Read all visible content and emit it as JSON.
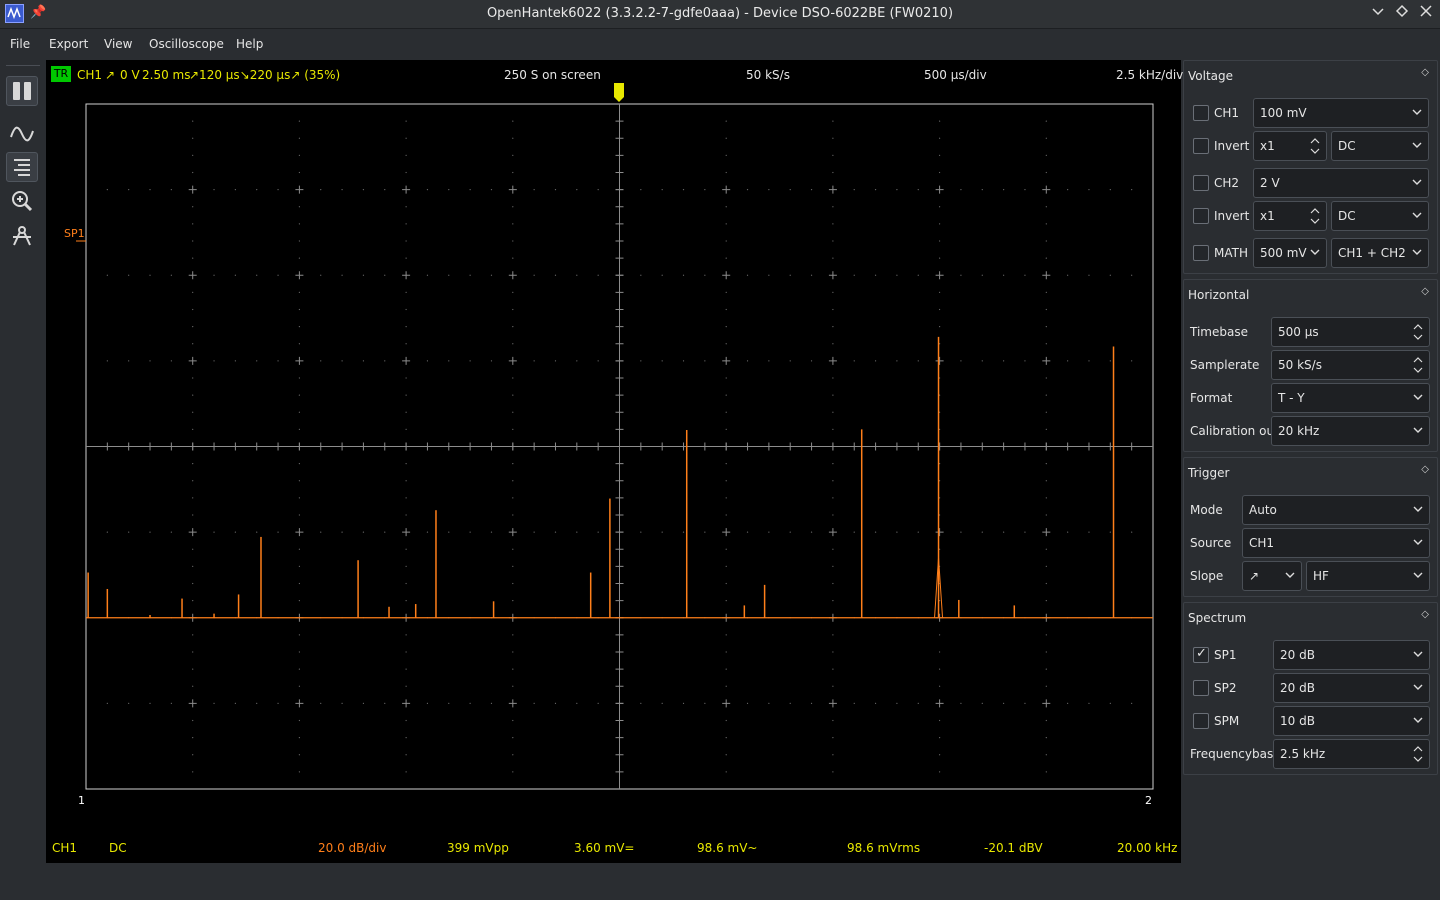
{
  "window": {
    "title": "OpenHantek6022 (3.3.2.2-7-gdfe0aaa) - Device DSO-6022BE (FW0210)"
  },
  "menu": [
    "File",
    "Export",
    "View",
    "Oscilloscope",
    "Help"
  ],
  "toolbar": {
    "items": [
      "pause-icon",
      "waveform-icon",
      "zoom-lines-icon",
      "zoom-icon",
      "measure-icon"
    ]
  },
  "scope": {
    "trigger_badge": "TR",
    "channel": "CH1",
    "slope_symbol": "↗",
    "trigger_level": "0 V",
    "trigger_pos": "2.50 ms",
    "pulse_info": "↗120 µs↘220 µs↗ (35%)",
    "samples_on_screen": "250 S on screen",
    "samplerate": "50 kS/s",
    "timebase": "500 µs/div",
    "freqbase": "2.5 kHz/div",
    "marker_label": "SP1",
    "cursor_1": "1",
    "cursor_2": "2",
    "colors": {
      "trace": "#ff7f1a",
      "grid": "#8c8c8c",
      "trigger": "#e8e800",
      "badge": "#00c800"
    }
  },
  "footer": {
    "channel": "CH1",
    "coupling": "DC",
    "db_div": "20.0 dB/div",
    "vpp": "399 mVpp",
    "vdc": "3.60 mV=",
    "vac": "98.6 mV~",
    "vrms": "98.6 mVrms",
    "dbv": "-20.1 dBV",
    "freq": "20.00 kHz"
  },
  "voltage": {
    "title": "Voltage",
    "ch1": {
      "label": "CH1",
      "checked": false,
      "gain": "100 mV"
    },
    "ch1_invert": {
      "label": "Invert",
      "checked": false,
      "probe": "x1",
      "coupling": "DC"
    },
    "ch2": {
      "label": "CH2",
      "checked": false,
      "gain": "2 V"
    },
    "ch2_invert": {
      "label": "Invert",
      "checked": false,
      "probe": "x1",
      "coupling": "DC"
    },
    "math": {
      "label": "MATH",
      "checked": false,
      "gain": "500 mV",
      "mode": "CH1 + CH2"
    }
  },
  "horizontal": {
    "title": "Horizontal",
    "timebase_label": "Timebase",
    "timebase": "500 µs",
    "samplerate_label": "Samplerate",
    "samplerate": "50 kS/s",
    "format_label": "Format",
    "format": "T - Y",
    "calibration_label": "Calibration out",
    "calibration": "20 kHz"
  },
  "trigger": {
    "title": "Trigger",
    "mode_label": "Mode",
    "mode": "Auto",
    "source_label": "Source",
    "source": "CH1",
    "slope_label": "Slope",
    "slope": "↗",
    "filter": "HF"
  },
  "spectrum": {
    "title": "Spectrum",
    "sp1": {
      "label": "SP1",
      "checked": true,
      "value": "20 dB"
    },
    "sp2": {
      "label": "SP2",
      "checked": false,
      "value": "20 dB"
    },
    "spm": {
      "label": "SPM",
      "checked": false,
      "value": "10 dB"
    },
    "freqbase_label": "Frequencybase",
    "freqbase": "2.5 kHz"
  }
}
